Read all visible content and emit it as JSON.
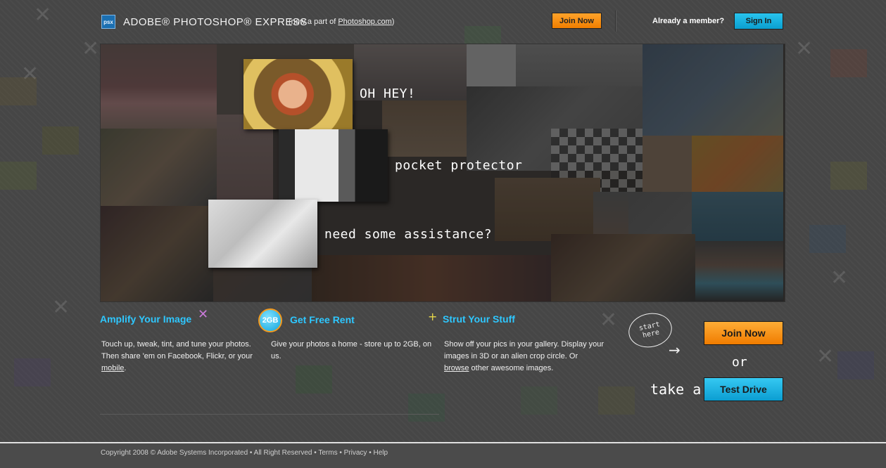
{
  "header": {
    "logo_text": "psx",
    "brand": "ADOBE® PHOTOSHOP® EXPRESS",
    "brand_sub_prefix": "(now a part of ",
    "brand_sub_link": "Photoshop.com",
    "brand_sub_suffix": ")",
    "join_label": "Join Now",
    "member_text": "Already a member?",
    "signin_label": "Sign In"
  },
  "hero": {
    "caption1": "OH HEY!",
    "caption2": "pocket protector",
    "caption3": "need some assistance?"
  },
  "features": [
    {
      "title": "Amplify Your Image",
      "text_before": "Touch up, tweak, tint, and tune your photos. Then share 'em on Facebook, Flickr, or your ",
      "link": "mobile",
      "text_after": "."
    },
    {
      "badge": "2GB",
      "title": "Get Free Rent",
      "text": "Give your photos a home - store up to 2GB, on us."
    },
    {
      "title": "Strut Your Stuff",
      "text_before": "Show off your pics in your gallery. Display your images in 3D or an alien crop circle. Or ",
      "link": "browse",
      "text_after": " other awesome images."
    }
  ],
  "cta": {
    "start_here": "start here",
    "join_label": "Join Now",
    "or_text": "or",
    "take_a": "take a",
    "test_drive_label": "Test Drive"
  },
  "footer": {
    "text": "Copyright 2008 © Adobe Systems Incorporated • All Right Reserved • Terms • Privacy • Help"
  },
  "colors": {
    "accent_blue": "#2ec7ff",
    "accent_orange": "#f08a00",
    "background": "#474747"
  }
}
